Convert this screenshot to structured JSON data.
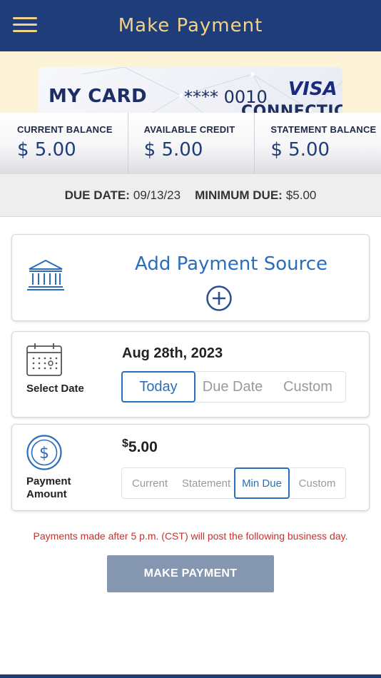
{
  "header": {
    "title": "Make Payment",
    "menu_icon": "hamburger-menu-icon",
    "background": "#1f3d7a",
    "title_color": "#f1d28a"
  },
  "card": {
    "name": "MY CARD",
    "number": "**** 0010",
    "brand": "VISA",
    "bank": "CONNECTICUT"
  },
  "balances": [
    {
      "label": "CURRENT BALANCE",
      "value": "$ 5.00"
    },
    {
      "label": "AVAILABLE CREDIT",
      "value": "$ 5.00"
    },
    {
      "label": "STATEMENT BALANCE",
      "value": "$ 5.00"
    }
  ],
  "due": {
    "date_label": "DUE DATE:",
    "date_value": "09/13/23",
    "min_label": "MINIMUM DUE:",
    "min_value": "$5.00"
  },
  "source": {
    "title": "Add Payment Source",
    "icon": "bank-icon",
    "add_icon": "plus-circle-icon"
  },
  "date_section": {
    "label": "Select Date",
    "value": "Aug 28th, 2023",
    "icon": "calendar-icon",
    "options": [
      "Today",
      "Due Date",
      "Custom"
    ],
    "selected": "Today"
  },
  "amount_section": {
    "label_line1": "Payment",
    "label_line2": "Amount",
    "currency_symbol": "$",
    "value": "5.00",
    "icon": "dollar-circle-icon",
    "options": [
      "Current",
      "Statement",
      "Min Due",
      "Custom"
    ],
    "selected": "Min Due"
  },
  "notice": "Payments made after 5 p.m. (CST) will post the following business day.",
  "submit_label": "MAKE PAYMENT",
  "colors": {
    "accent": "#2a6ebb",
    "warning": "#c9302c",
    "button_disabled": "#8597b0"
  }
}
